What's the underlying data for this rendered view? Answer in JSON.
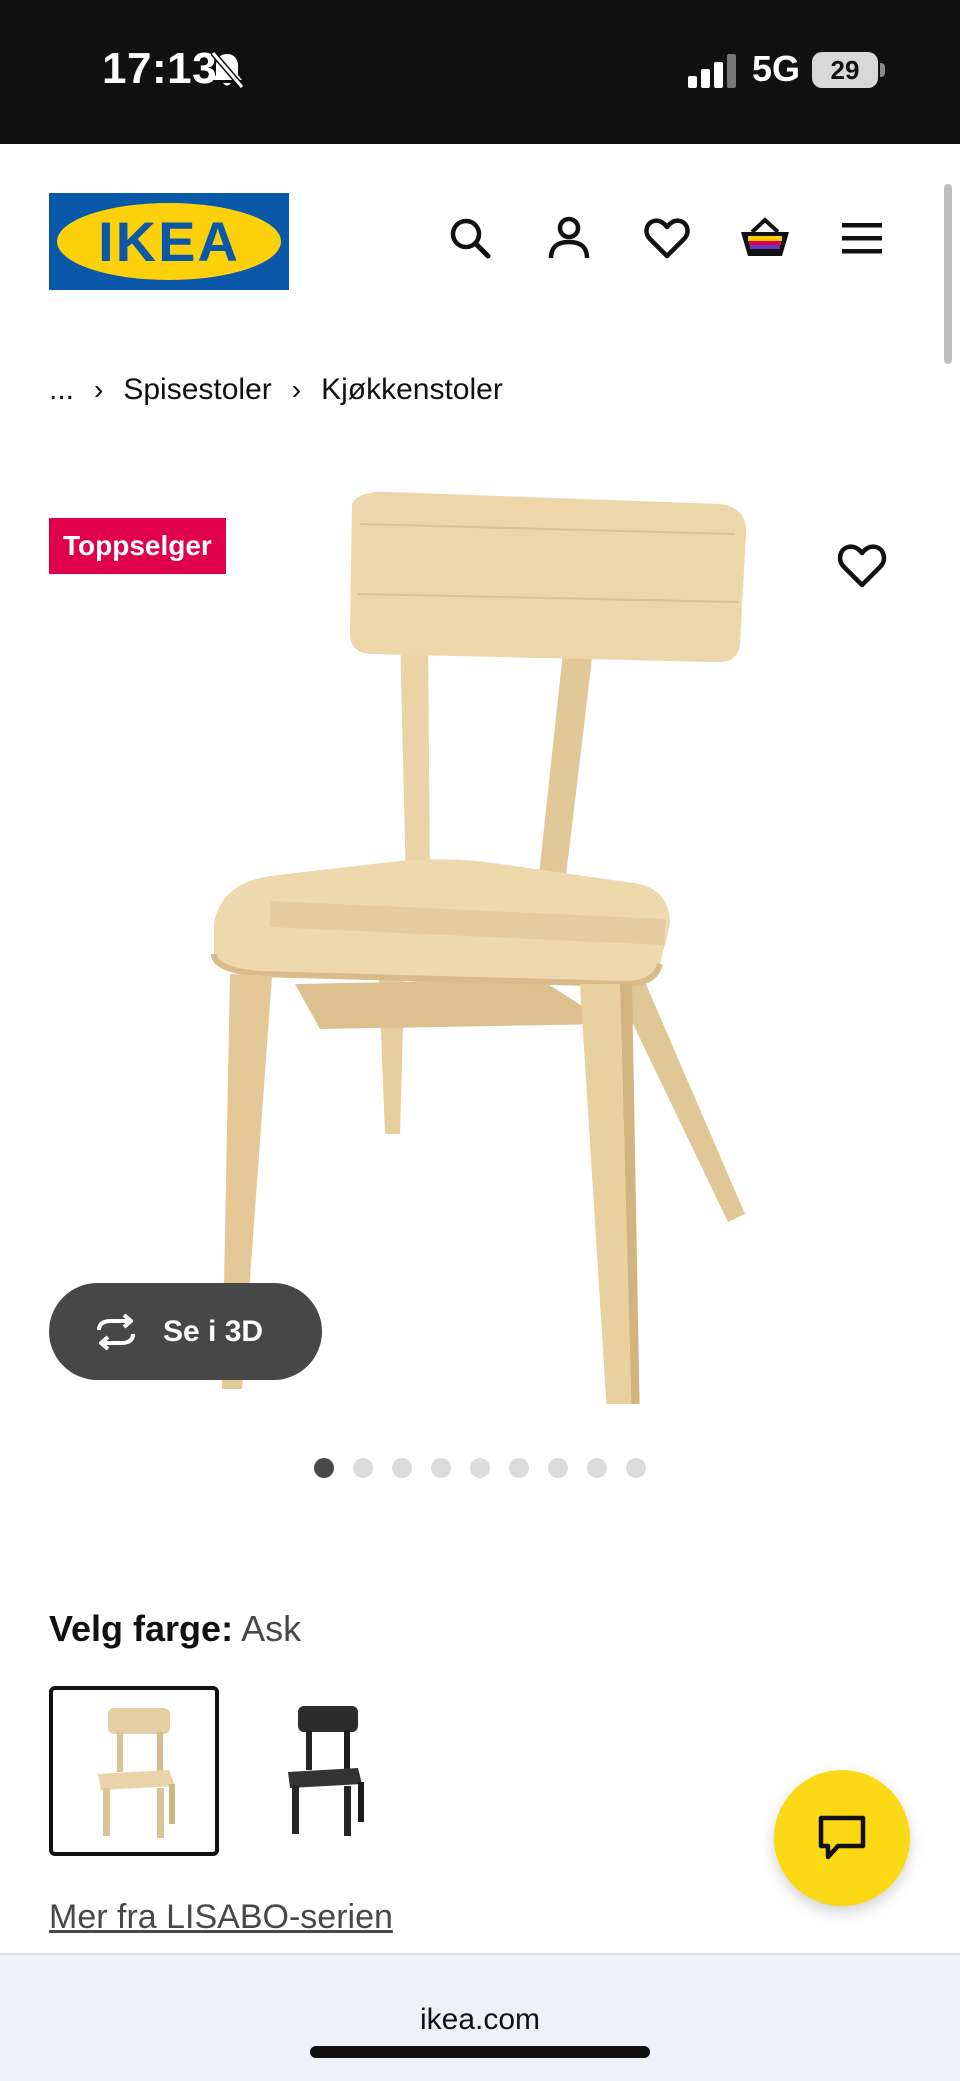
{
  "status_bar": {
    "time": "17:13",
    "network": "5G",
    "battery": "29",
    "icons": [
      "bell-muted-icon",
      "signal-icon",
      "battery-icon"
    ]
  },
  "header": {
    "logo_text": "IKEA",
    "icons": [
      "search-icon",
      "user-icon",
      "heart-icon",
      "cart-icon",
      "menu-icon"
    ],
    "colors": {
      "logo_blue": "#0a58a8",
      "logo_yellow": "#fcd10c"
    }
  },
  "breadcrumb": {
    "items": [
      "...",
      "Spisestoler",
      "Kjøkkenstoler"
    ],
    "separator": "›"
  },
  "product_image": {
    "badge": "Toppselger",
    "badge_color": "#e0004b",
    "view_3d_label": "Se i 3D",
    "carousel": {
      "total": 9,
      "active_index": 0
    }
  },
  "color_selector": {
    "label": "Velg farge:",
    "value": "Ask",
    "options": [
      {
        "name": "Ask",
        "selected": true,
        "tone": "#e6cfa4"
      },
      {
        "name": "black",
        "selected": false,
        "tone": "#2a2a2a"
      }
    ]
  },
  "series_link": "Mer fra LISABO-serien",
  "chat": {
    "icon": "chat-bubble-icon",
    "color": "#fbd914"
  },
  "browser": {
    "url": "ikea.com"
  }
}
